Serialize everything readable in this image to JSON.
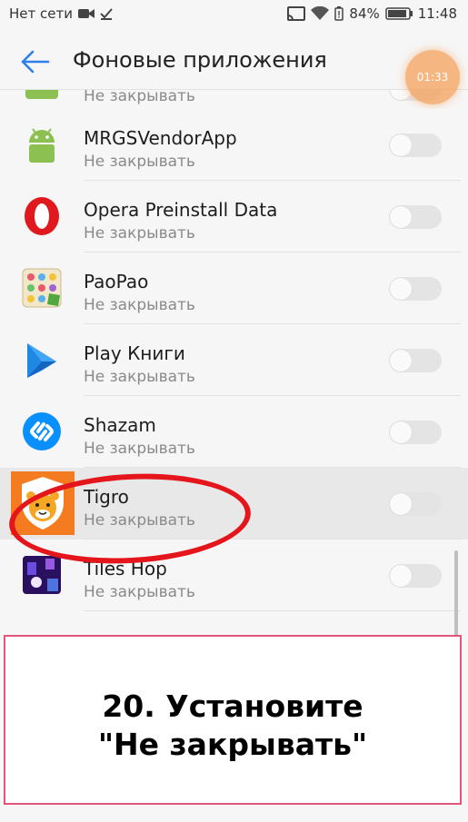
{
  "statusbar": {
    "network": "Нет сети",
    "battery": "84%",
    "time": "11:48"
  },
  "header": {
    "title": "Фоновые приложения",
    "timer": "01:33"
  },
  "partial_app": {
    "subtitle": "Не закрывать"
  },
  "apps": [
    {
      "name": "MRGSVendorApp",
      "subtitle": "Не закрывать",
      "icon": "android-icon"
    },
    {
      "name": "Opera Preinstall Data",
      "subtitle": "Не закрывать",
      "icon": "opera-icon"
    },
    {
      "name": "PaoPao",
      "subtitle": "Не закрывать",
      "icon": "paopao-icon"
    },
    {
      "name": "Play Книги",
      "subtitle": "Не закрывать",
      "icon": "play-books-icon"
    },
    {
      "name": "Shazam",
      "subtitle": "Не закрывать",
      "icon": "shazam-icon"
    },
    {
      "name": "Tigro",
      "subtitle": "Не закрывать",
      "icon": "tigro-icon",
      "highlighted": true
    },
    {
      "name": "Tiles Hop",
      "subtitle": "Не закрывать",
      "icon": "tiles-hop-icon"
    }
  ],
  "instruction": {
    "line1": "20. Установите",
    "line2": "\"Не закрывать\""
  },
  "colors": {
    "accent": "#2e7fe8",
    "annotation": "#e4161c",
    "overlay_border": "#e0557a"
  }
}
